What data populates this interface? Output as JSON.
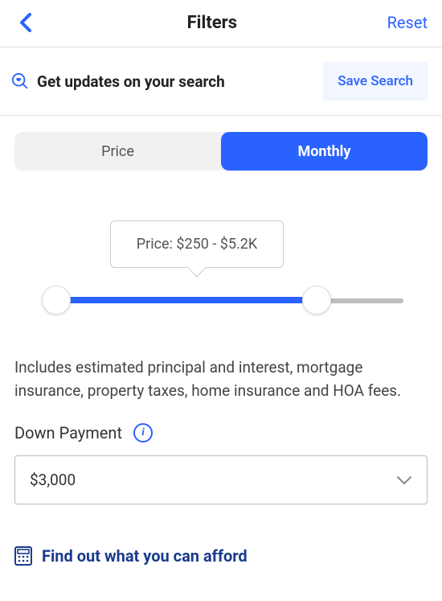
{
  "header": {
    "title": "Filters",
    "reset": "Reset"
  },
  "save_section": {
    "prompt": "Get updates on your search",
    "button": "Save Search"
  },
  "tabs": {
    "price": "Price",
    "monthly": "Monthly",
    "active": "monthly"
  },
  "slider": {
    "tooltip": "Price: $250 - $5.2K"
  },
  "description": "Includes estimated principal and interest, mortgage insurance, property taxes, home insurance and HOA fees.",
  "down_payment": {
    "label": "Down Payment",
    "value": "$3,000"
  },
  "afford_link": "Find out what you can afford"
}
